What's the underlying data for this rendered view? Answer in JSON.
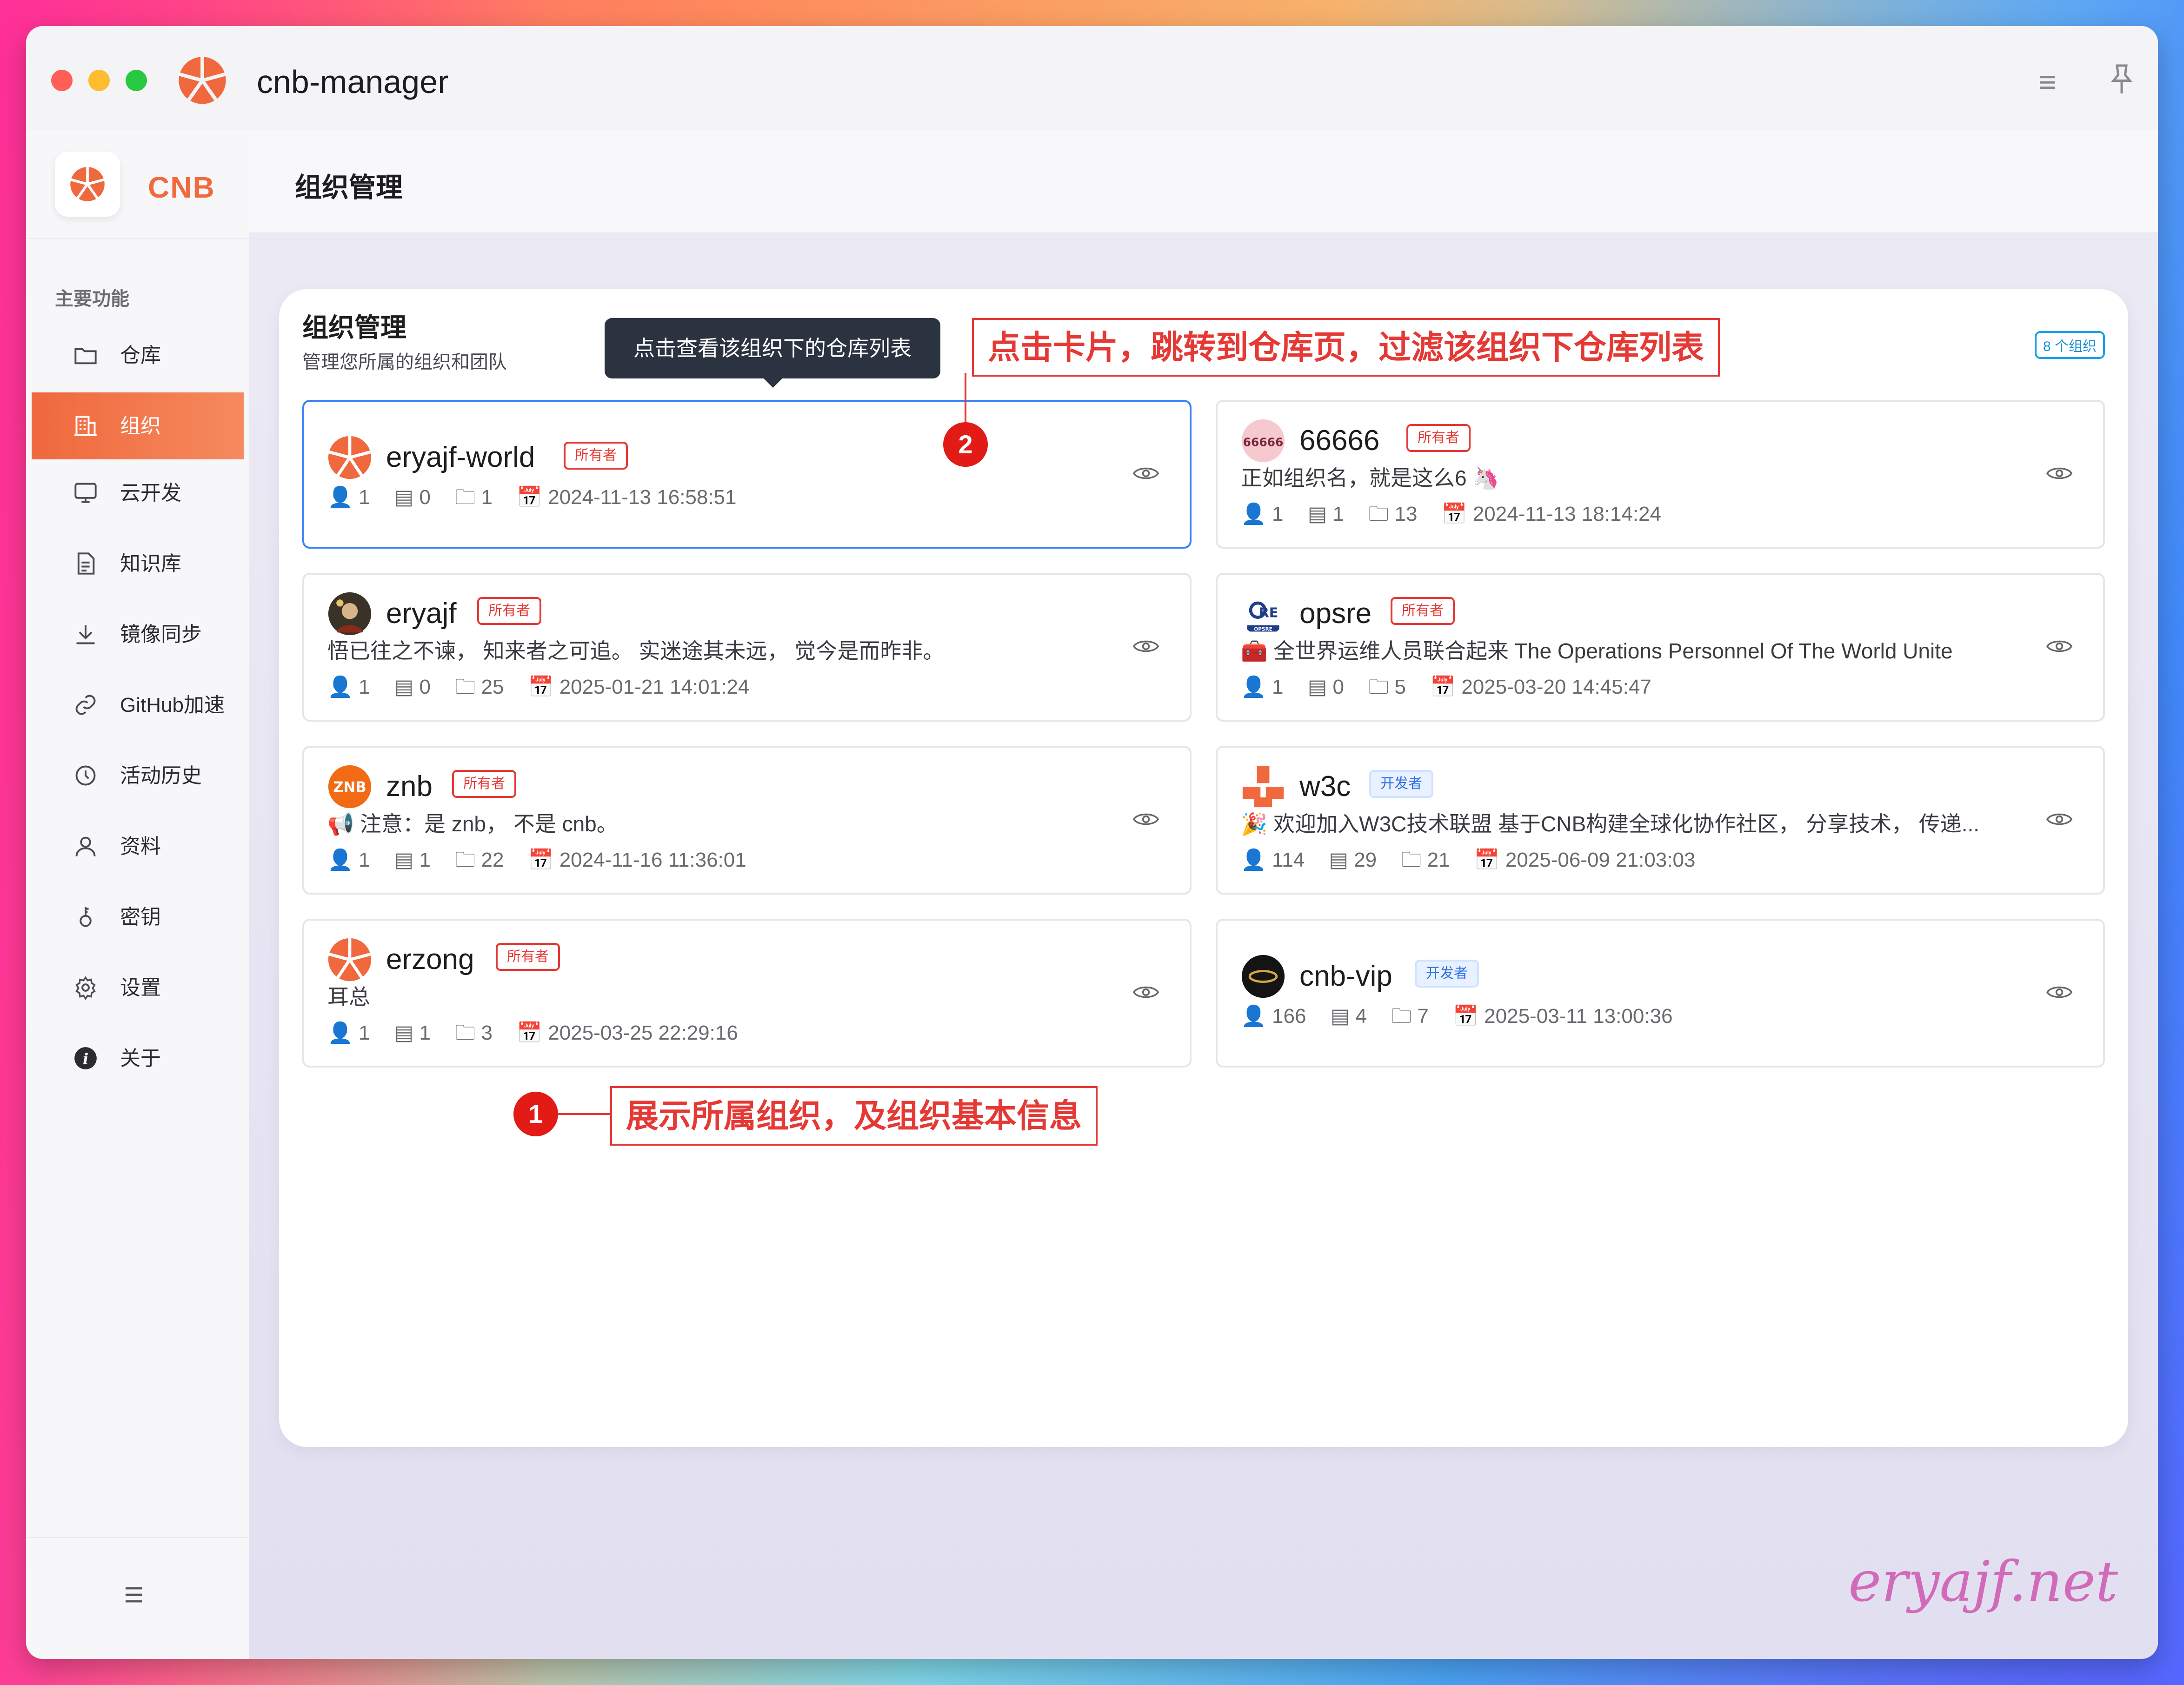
{
  "window": {
    "title": "cnb-manager"
  },
  "sidebar": {
    "brand": "CNB",
    "section_label": "主要功能",
    "items": [
      {
        "label": "仓库",
        "icon": "folder-icon",
        "active": false
      },
      {
        "label": "组织",
        "icon": "building-icon",
        "active": true
      },
      {
        "label": "云开发",
        "icon": "monitor-icon",
        "active": false
      },
      {
        "label": "知识库",
        "icon": "document-icon",
        "active": false
      },
      {
        "label": "镜像同步",
        "icon": "download-icon",
        "active": false
      },
      {
        "label": "GitHub加速",
        "icon": "link-icon",
        "active": false
      },
      {
        "label": "活动历史",
        "icon": "clock-icon",
        "active": false
      },
      {
        "label": "资料",
        "icon": "user-icon",
        "active": false
      },
      {
        "label": "密钥",
        "icon": "key-icon",
        "active": false
      },
      {
        "label": "设置",
        "icon": "gear-icon",
        "active": false
      },
      {
        "label": "关于",
        "icon": "info-icon",
        "active": false
      }
    ]
  },
  "header": {
    "title": "组织管理"
  },
  "panel": {
    "title": "组织管理",
    "subtitle": "管理您所属的组织和团队",
    "count_badge": "8 个组织"
  },
  "tooltip": "点击查看该组织下的仓库列表",
  "annotations": {
    "a1_number": "1",
    "a1_text": "展示所属组织，及组织基本信息",
    "a2_number": "2",
    "a2_text": "点击卡片，跳转到仓库页，过滤该组织下仓库列表"
  },
  "orgs": [
    {
      "name": "eryajf-world",
      "role": "所有者",
      "desc": "",
      "members": "1",
      "orgs": "0",
      "repos": "1",
      "date": "2024-11-13 16:58:51"
    },
    {
      "name": "66666",
      "role": "所有者",
      "desc": "正如组织名，就是这么6 🦄",
      "members": "1",
      "orgs": "1",
      "repos": "13",
      "date": "2024-11-13 18:14:24"
    },
    {
      "name": "eryajf",
      "role": "所有者",
      "desc": "悟已往之不谏， 知来者之可追。 实迷途其未远， 觉今是而昨非。",
      "members": "1",
      "orgs": "0",
      "repos": "25",
      "date": "2025-01-21 14:01:24"
    },
    {
      "name": "opsre",
      "role": "所有者",
      "desc": "🧰 全世界运维人员联合起来 The Operations Personnel Of The World Unite",
      "members": "1",
      "orgs": "0",
      "repos": "5",
      "date": "2025-03-20 14:45:47"
    },
    {
      "name": "znb",
      "role": "所有者",
      "desc": "📢 注意：是 znb， 不是 cnb。",
      "members": "1",
      "orgs": "1",
      "repos": "22",
      "date": "2024-11-16 11:36:01"
    },
    {
      "name": "w3c",
      "role": "开发者",
      "desc": "🎉 欢迎加入W3C技术联盟 基于CNB构建全球化协作社区， 分享技术， 传递...",
      "members": "114",
      "orgs": "29",
      "repos": "21",
      "date": "2025-06-09 21:03:03"
    },
    {
      "name": "erzong",
      "role": "所有者",
      "desc": "耳总",
      "members": "1",
      "orgs": "1",
      "repos": "3",
      "date": "2025-03-25 22:29:16"
    },
    {
      "name": "cnb-vip",
      "role": "开发者",
      "desc": "",
      "members": "166",
      "orgs": "4",
      "repos": "7",
      "date": "2025-03-11 13:00:36"
    }
  ],
  "avatar_labels": {
    "znb": "ZNB",
    "66666": "66666",
    "opsre": "OPSRE"
  },
  "watermark": "eryajf.net",
  "colors": {
    "accent": "#f0683d",
    "annotation": "#e53935",
    "selected_border": "#3b82f6"
  }
}
